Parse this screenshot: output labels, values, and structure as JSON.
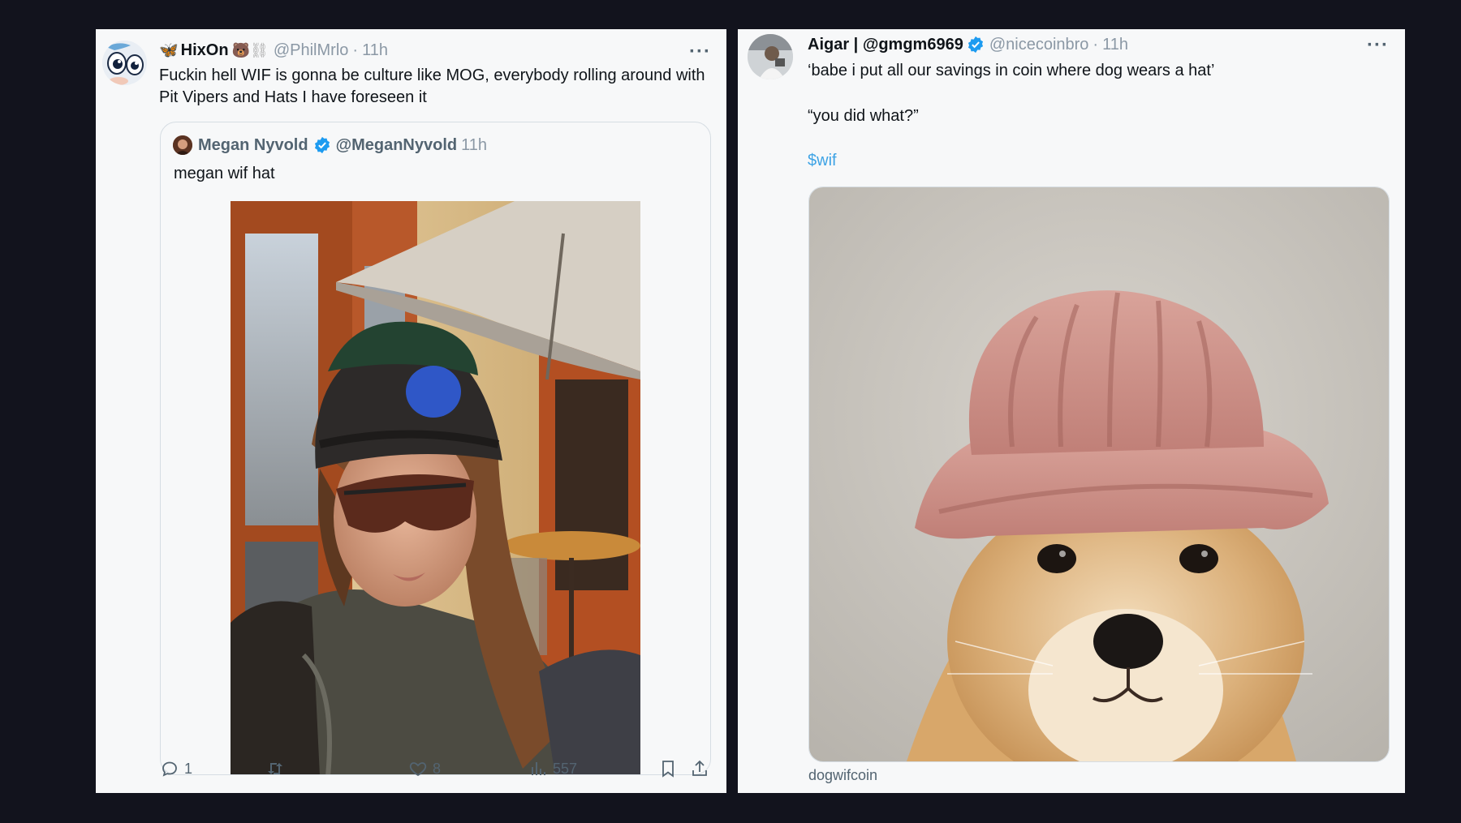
{
  "left_tweet": {
    "name": "HixOn",
    "name_emoji_prefix": "🦋",
    "name_emoji_suffix": "🐻⛓",
    "handle": "@PhilMrlo",
    "sep": "·",
    "time": "11h",
    "more": "···",
    "text_line1": "Fuckin hell WIF is gonna be culture like MOG, everybody rolling around with",
    "text_line2": "Pit Vipers and Hats I have foreseen it",
    "quote": {
      "name": "Megan Nyvold",
      "handle": "@MeganNyvold",
      "time": "11h",
      "text": "megan wif hat"
    },
    "actions": {
      "replies": "1",
      "retweets": "",
      "likes": "8",
      "views": "557"
    }
  },
  "right_tweet": {
    "name": "Aigar | @gmgm6969",
    "handle": "@nicecoinbro",
    "sep": "·",
    "time": "11h",
    "more": "···",
    "line1": "‘babe i put all our savings in coin where dog wears a hat’",
    "line2": "“you did what?”",
    "link": "$wif",
    "image_caption": "dogwifcoin"
  },
  "colors": {
    "background": "#12131d",
    "card": "#f7f8f9",
    "link": "#3ea3e5",
    "verified": "#1d9bf0",
    "muted": "#8b98a5"
  }
}
